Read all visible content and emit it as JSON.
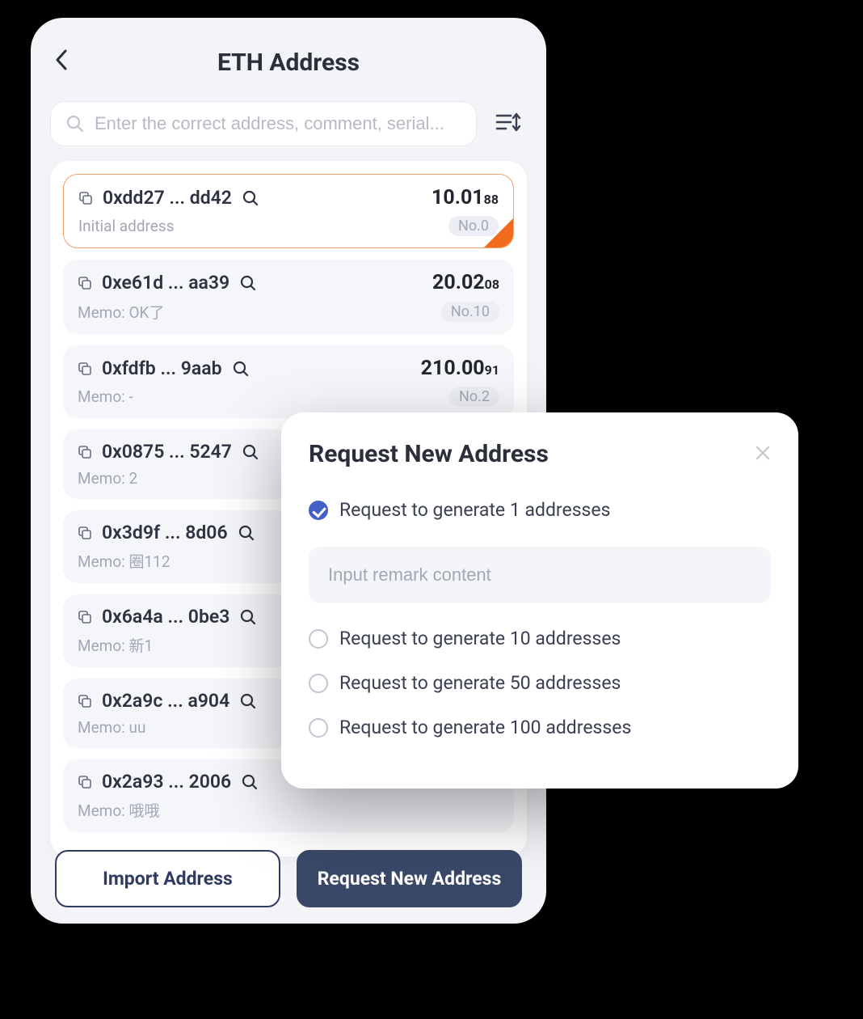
{
  "header": {
    "title": "ETH Address"
  },
  "search": {
    "placeholder": "Enter the correct address, comment, serial..."
  },
  "addresses": [
    {
      "addr": "0xdd27 ... dd42",
      "balance_whole": "10.01",
      "balance_sub": "88",
      "memo": "Initial address",
      "no": "No.0",
      "selected": true
    },
    {
      "addr": "0xe61d ... aa39",
      "balance_whole": "20.02",
      "balance_sub": "08",
      "memo": "Memo: OK了",
      "no": "No.10",
      "selected": false
    },
    {
      "addr": "0xfdfb ... 9aab",
      "balance_whole": "210.00",
      "balance_sub": "91",
      "memo": "Memo: -",
      "no": "No.2",
      "selected": false
    },
    {
      "addr": "0x0875 ... 5247",
      "balance_whole": "",
      "balance_sub": "",
      "memo": "Memo: 2",
      "no": "",
      "selected": false
    },
    {
      "addr": "0x3d9f ... 8d06",
      "balance_whole": "",
      "balance_sub": "",
      "memo": "Memo: 圈112",
      "no": "",
      "selected": false
    },
    {
      "addr": "0x6a4a ... 0be3",
      "balance_whole": "",
      "balance_sub": "",
      "memo": "Memo: 新1",
      "no": "",
      "selected": false
    },
    {
      "addr": "0x2a9c ... a904",
      "balance_whole": "",
      "balance_sub": "",
      "memo": "Memo: uu",
      "no": "",
      "selected": false
    },
    {
      "addr": "0x2a93 ... 2006",
      "balance_whole": "",
      "balance_sub": "",
      "memo": "Memo: 哦哦",
      "no": "",
      "selected": false
    }
  ],
  "footer": {
    "import_label": "Import Address",
    "request_label": "Request New Address"
  },
  "modal": {
    "title": "Request New Address",
    "options": [
      {
        "label": "Request to generate 1 addresses",
        "checked": true
      },
      {
        "label": "Request to generate 10 addresses",
        "checked": false
      },
      {
        "label": "Request to generate 50 addresses",
        "checked": false
      },
      {
        "label": "Request to generate 100 addresses",
        "checked": false
      }
    ],
    "remark_placeholder": "Input remark content"
  }
}
